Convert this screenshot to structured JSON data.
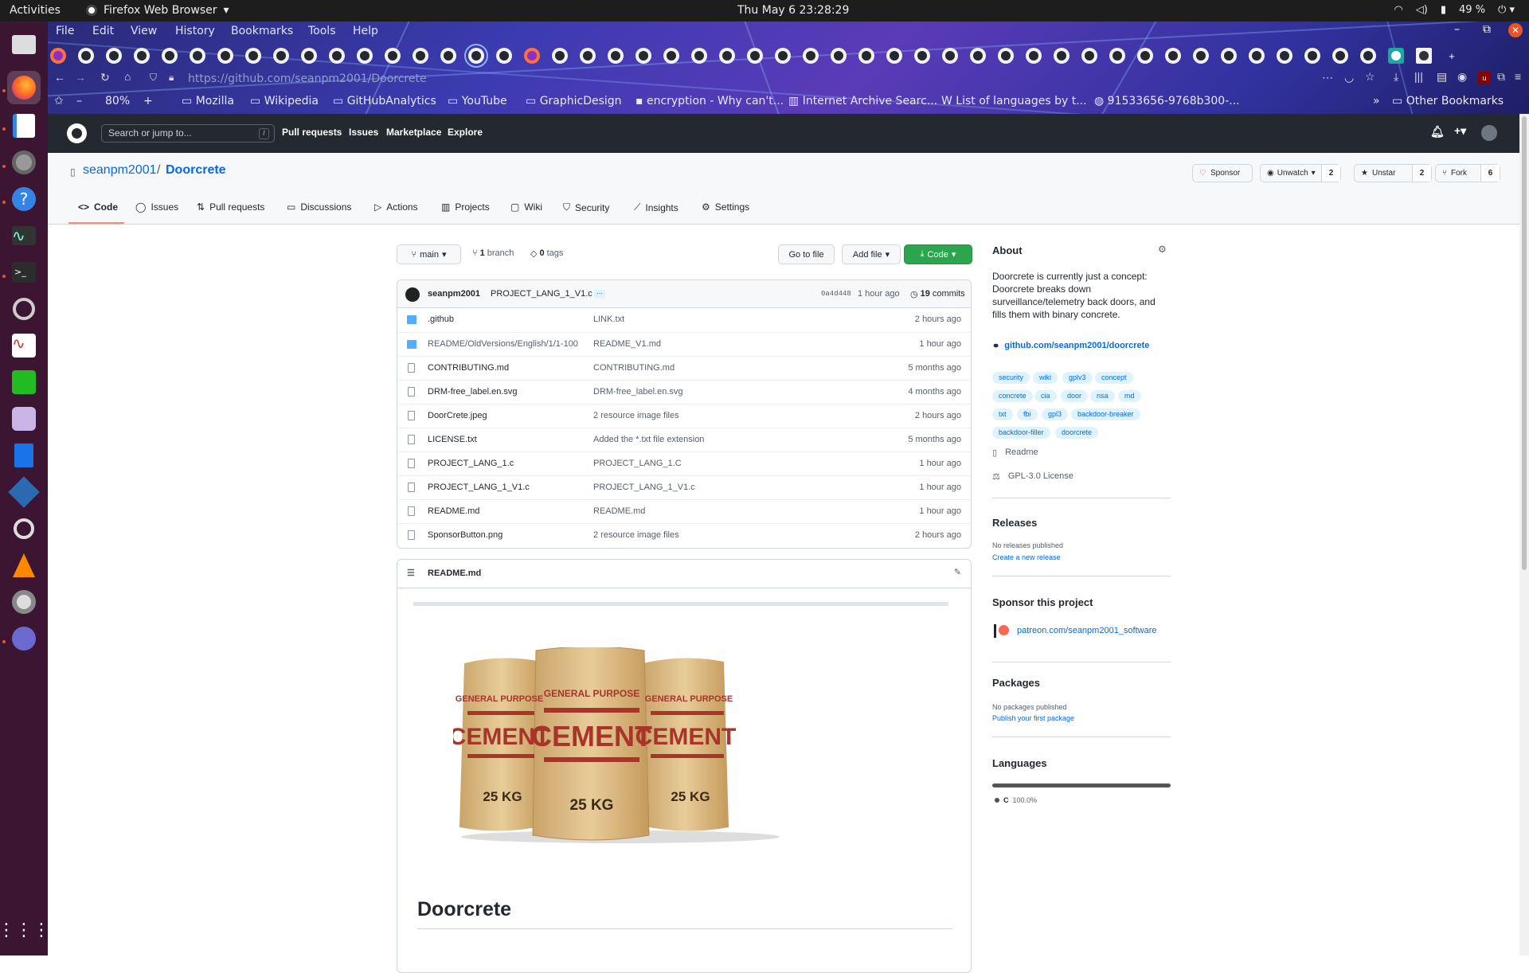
{
  "system": {
    "activities": "Activities",
    "app_name": "Firefox Web Browser",
    "clock": "Thu May 6  23:28:29",
    "battery": "49 %"
  },
  "browser": {
    "menu": [
      "File",
      "Edit",
      "View",
      "History",
      "Bookmarks",
      "Tools",
      "Help"
    ],
    "url": "https://github.com/seanpm2001/Doorcrete",
    "zoom": "80%",
    "bookmarks": [
      "Mozilla",
      "Wikipedia",
      "GitHubAnalytics",
      "YouTube",
      "GraphicDesign",
      "encryption - Why can't...",
      "Internet Archive Searc...",
      "List of languages by t...",
      "91533656-9768b300-...",
      "Other Bookmarks"
    ]
  },
  "github": {
    "search_placeholder": "Search or jump to...",
    "search_key": "/",
    "nav": [
      "Pull requests",
      "Issues",
      "Marketplace",
      "Explore"
    ]
  },
  "repo": {
    "owner": "seanpm2001",
    "sep": "/",
    "name": "Doorcrete",
    "sponsor": "Sponsor",
    "unwatch": "Unwatch",
    "watch_count": "2",
    "unstar": "Unstar",
    "star_count": "2",
    "fork": "Fork",
    "fork_count": "6",
    "tabs": [
      "Code",
      "Issues",
      "Pull requests",
      "Discussions",
      "Actions",
      "Projects",
      "Wiki",
      "Security",
      "Insights",
      "Settings"
    ]
  },
  "toolbar": {
    "branch": "main",
    "branches_count": "1",
    "branches_label": "branch",
    "tags_count": "0",
    "tags_label": "tags",
    "go_to_file": "Go to file",
    "add_file": "Add file",
    "code": "Code"
  },
  "commit": {
    "author": "seanpm2001",
    "message": "PROJECT_LANG_1_V1.c",
    "ellipsis": "…",
    "sha": "0a4d448",
    "time": "1 hour ago",
    "count": "19",
    "count_label": "commits"
  },
  "files": [
    {
      "name": ".github",
      "type": "dir",
      "message": "LINK.txt",
      "time": "2 hours ago"
    },
    {
      "name": "README/OldVersions/English/1/1-100",
      "type": "dir",
      "message": "README_V1.md",
      "time": "1 hour ago"
    },
    {
      "name": "CONTRIBUTING.md",
      "type": "file",
      "message": "CONTRIBUTING.md",
      "time": "5 months ago"
    },
    {
      "name": "DRM-free_label.en.svg",
      "type": "file",
      "message": "DRM-free_label.en.svg",
      "time": "4 months ago"
    },
    {
      "name": "DoorCrete.jpeg",
      "type": "file",
      "message": "2 resource image files",
      "time": "2 hours ago"
    },
    {
      "name": "LICENSE.txt",
      "type": "file",
      "message": "Added the *.txt file extension",
      "time": "5 months ago"
    },
    {
      "name": "PROJECT_LANG_1.c",
      "type": "file",
      "message": "PROJECT_LANG_1.C",
      "time": "1 hour ago"
    },
    {
      "name": "PROJECT_LANG_1_V1.c",
      "type": "file",
      "message": "PROJECT_LANG_1_V1.c",
      "time": "1 hour ago"
    },
    {
      "name": "README.md",
      "type": "file",
      "message": "README.md",
      "time": "1 hour ago"
    },
    {
      "name": "SponsorButton.png",
      "type": "file",
      "message": "2 resource image files",
      "time": "2 hours ago"
    }
  ],
  "readme": {
    "filename": "README.md",
    "bag_left": {
      "top": "GENERAL PURPOSE",
      "main": "CEMENT",
      "weight": "25 KG"
    },
    "bag_center": {
      "top": "GENERAL PURPOSE",
      "main": "CEMENT",
      "weight": "25 KG"
    },
    "bag_right": {
      "top": "GENERAL PURPOSE",
      "main": "CEMENT",
      "weight": "25 KG"
    },
    "heading": "Doorcrete"
  },
  "about": {
    "title": "About",
    "description": "Doorcrete is currently just a concept: Doorcrete breaks down surveillance/telemetry back doors, and fills them with binary concrete.",
    "link": "github.com/seanpm2001/doorcrete",
    "topics": [
      "security",
      "wiki",
      "gplv3",
      "concept",
      "concrete",
      "cia",
      "door",
      "nsa",
      "md",
      "txt",
      "fbi",
      "gpl3",
      "backdoor-breaker",
      "backdoor-filler",
      "doorcrete"
    ],
    "readme": "Readme",
    "license": "GPL-3.0 License"
  },
  "releases": {
    "title": "Releases",
    "none": "No releases published",
    "create": "Create a new release"
  },
  "sponsor": {
    "title": "Sponsor this project",
    "link": "patreon.com/seanpm2001_software"
  },
  "packages": {
    "title": "Packages",
    "none": "No packages published",
    "publish": "Publish your first package"
  },
  "languages": {
    "title": "Languages",
    "items": [
      {
        "name": "C",
        "percent": "100.0%",
        "share": 1.0,
        "color": "#555555"
      }
    ]
  },
  "colors": {
    "accent": "#0969da",
    "green": "#2da44e",
    "header": "#24292f"
  }
}
